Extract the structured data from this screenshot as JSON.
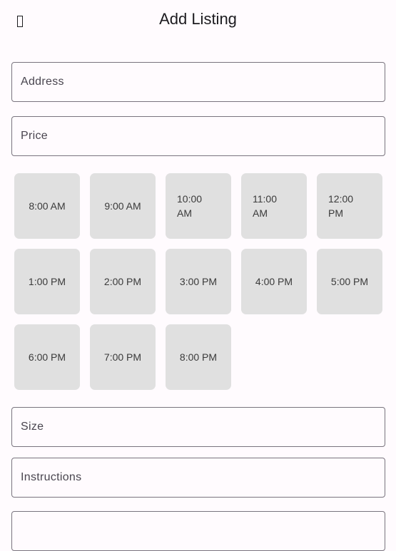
{
  "app_bar": {
    "title": "Add Listing",
    "back_icon": "back-arrow-icon"
  },
  "form": {
    "address_label": "Address",
    "price_label": "Price",
    "size_label": "Size",
    "instructions_label": "Instructions",
    "extra_field_label": ""
  },
  "time_slots": [
    {
      "label": "8:00 AM"
    },
    {
      "label": "9:00 AM"
    },
    {
      "label": "10:00 AM"
    },
    {
      "label": "11:00 AM"
    },
    {
      "label": "12:00 PM"
    },
    {
      "label": "1:00 PM"
    },
    {
      "label": "2:00 PM"
    },
    {
      "label": "3:00 PM"
    },
    {
      "label": "4:00 PM"
    },
    {
      "label": "5:00 PM"
    },
    {
      "label": "6:00 PM"
    },
    {
      "label": "7:00 PM"
    },
    {
      "label": "8:00 PM"
    }
  ],
  "colors": {
    "background": "#fffbfe",
    "field_border": "#79747e",
    "slot_background": "#e0e0e0"
  }
}
